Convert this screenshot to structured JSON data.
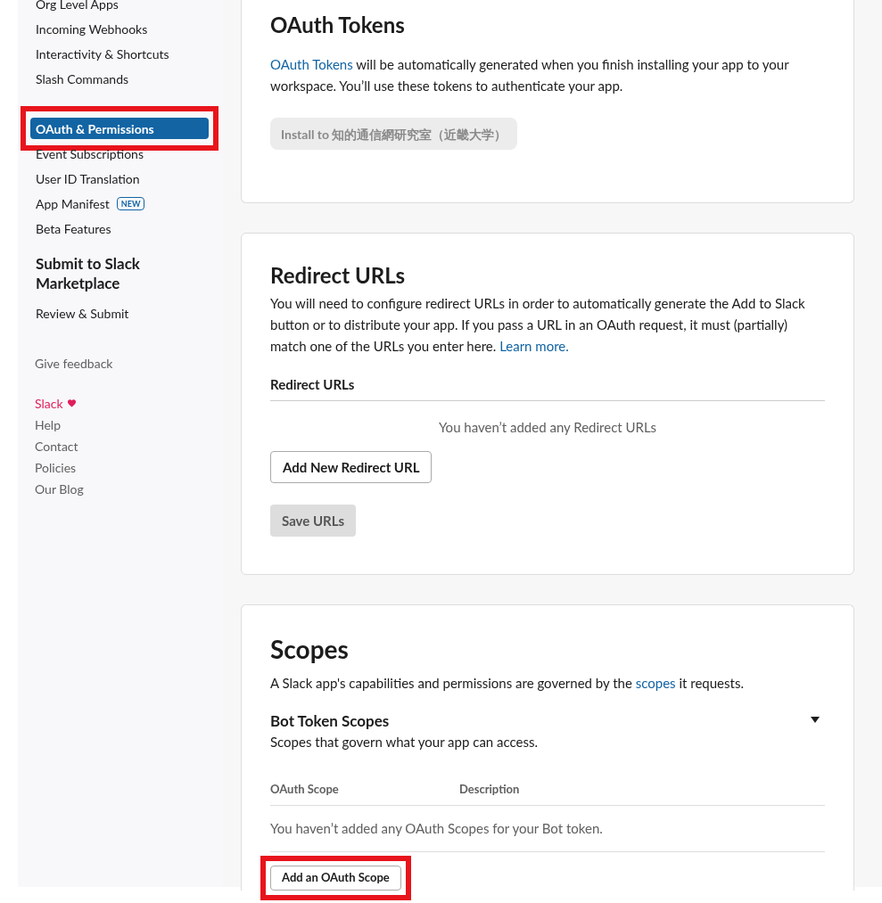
{
  "sidebar": {
    "items": [
      {
        "label": "Org Level Apps",
        "selected": false,
        "highlighted": false
      },
      {
        "label": "Incoming Webhooks",
        "selected": false,
        "highlighted": false
      },
      {
        "label": "Interactivity & Shortcuts",
        "selected": false,
        "highlighted": false
      },
      {
        "label": "Slash Commands",
        "selected": false,
        "highlighted": false
      },
      {
        "label": "OAuth & Permissions",
        "selected": true,
        "highlighted": true
      },
      {
        "label": "Event Subscriptions",
        "selected": false,
        "highlighted": false
      },
      {
        "label": "User ID Translation",
        "selected": false,
        "highlighted": false
      },
      {
        "label": "App Manifest",
        "badge": "NEW",
        "selected": false,
        "highlighted": false
      },
      {
        "label": "Beta Features",
        "selected": false,
        "highlighted": false
      }
    ],
    "section_title": "Submit to Slack Marketplace",
    "section_items": [
      {
        "label": "Review & Submit",
        "selected": false
      }
    ],
    "feedback": "Give feedback",
    "footer_links": [
      {
        "label": "Slack",
        "kind": "brand"
      },
      {
        "label": "Help",
        "kind": "plain"
      },
      {
        "label": "Contact",
        "kind": "plain"
      },
      {
        "label": "Policies",
        "kind": "plain"
      },
      {
        "label": "Our Blog",
        "kind": "plain"
      }
    ]
  },
  "oauth_tokens": {
    "title": "OAuth Tokens",
    "link": "OAuth Tokens",
    "text": " will be automatically generated when you finish installing your app to your workspace. You’ll use these tokens to authenticate your app.",
    "install_button": {
      "label": "Install to 知的通信網研究室（近畿大学）",
      "disabled": true
    }
  },
  "redirect_urls": {
    "title": "Redirect URLs",
    "text": "You will need to configure redirect URLs in order to automatically generate the Add to Slack button or to distribute your app. If you pass a URL in an OAuth request, it must (partially) match one of the URLs you enter here.",
    "link": "Learn more.",
    "list_title": "Redirect URLs",
    "empty": "You haven’t added any Redirect URLs",
    "add_button": "Add New Redirect URL",
    "save_button": {
      "label": "Save URLs",
      "disabled": true
    }
  },
  "scopes": {
    "title": "Scopes",
    "text": "A Slack app's capabilities and permissions are governed by the ",
    "link": "scopes",
    "text_end": " it requests.",
    "bot": {
      "title": "Bot Token Scopes",
      "subtitle": "Scopes that govern what your app can access.",
      "expanded": true,
      "columns": [
        "OAuth Scope",
        "Description"
      ],
      "empty": "You haven’t added any OAuth Scopes for your Bot token.",
      "add_button": {
        "label": "Add an OAuth Scope",
        "highlighted": true
      }
    }
  }
}
